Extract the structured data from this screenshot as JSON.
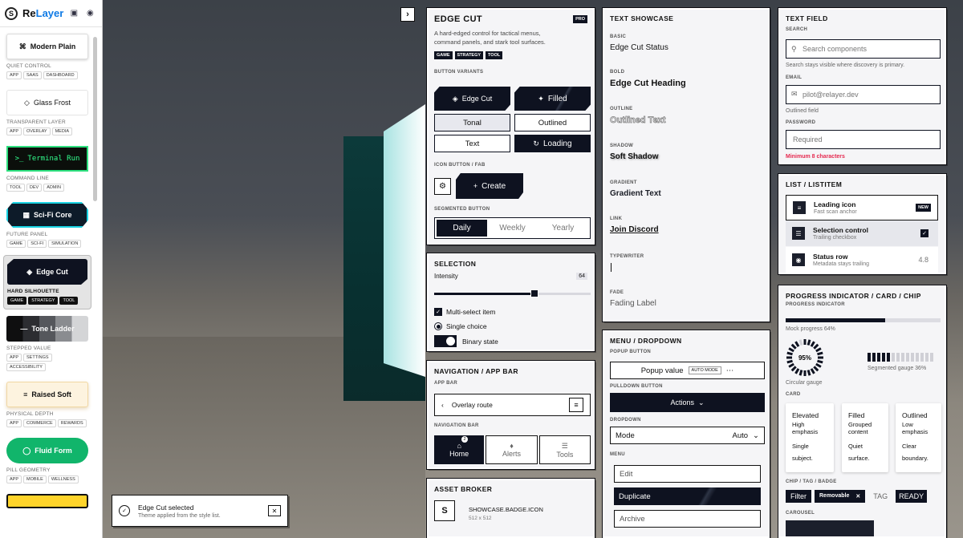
{
  "brand": {
    "name_a": "Re",
    "name_b": "Layer"
  },
  "styles": [
    {
      "name": "Modern Plain",
      "subtitle": "QUIET CONTROL",
      "chips": [
        "APP",
        "SAAS",
        "DASHBOARD"
      ],
      "icon": "command-icon"
    },
    {
      "name": "Glass Frost",
      "subtitle": "TRANSPARENT LAYER",
      "chips": [
        "APP",
        "OVERLAY",
        "MEDIA"
      ],
      "icon": "diamond-icon"
    },
    {
      "name": "Terminal Run",
      "subtitle": "COMMAND LINE",
      "chips": [
        "TOOL",
        "DEV",
        "ADMIN"
      ],
      "prefix": ">_"
    },
    {
      "name": "Sci-Fi Core",
      "subtitle": "FUTURE PANEL",
      "chips": [
        "GAME",
        "SCI-FI",
        "SIMULATION"
      ],
      "icon": "chip-icon"
    },
    {
      "name": "Edge Cut",
      "subtitle": "HARD SILHOUETTE",
      "chips": [
        "GAME",
        "STRATEGY",
        "TOOL"
      ],
      "icon": "tag-icon",
      "selected": true
    },
    {
      "name": "Tone Ladder",
      "subtitle": "STEPPED VALUE",
      "chips": [
        "APP",
        "SETTINGS",
        "ACCESSIBILITY"
      ],
      "icon": "dash-icon"
    },
    {
      "name": "Raised Soft",
      "subtitle": "PHYSICAL DEPTH",
      "chips": [
        "APP",
        "COMMERCE",
        "REWARDS"
      ],
      "icon": "layers-icon"
    },
    {
      "name": "Fluid Form",
      "subtitle": "PILL GEOMETRY",
      "chips": [
        "APP",
        "MOBILE",
        "WELLNESS"
      ],
      "icon": "circle-icon"
    }
  ],
  "toast": {
    "title": "Edge Cut selected",
    "body": "Theme applied from the style list."
  },
  "edgecut": {
    "title": "EDGE CUT",
    "pro": "PRO",
    "desc1": "A hard-edged control for tactical menus,",
    "desc2": "command panels, and stark tool surfaces.",
    "tags": [
      "GAME",
      "STRATEGY",
      "TOOL"
    ],
    "variants_label": "BUTTON VARIANTS",
    "b1": "Edge Cut",
    "b2": "Filled",
    "b3": "Tonal",
    "b4": "Outlined",
    "b5": "Text",
    "b6": "Loading",
    "fab_label": "ICON BUTTON / FAB",
    "create": "Create",
    "seg_label": "SEGMENTED BUTTON",
    "seg": [
      "Daily",
      "Weekly",
      "Yearly"
    ]
  },
  "selection": {
    "title": "SELECTION",
    "intensity_label": "Intensity",
    "intensity": 64,
    "multi": "Multi-select item",
    "single": "Single choice",
    "binary": "Binary state"
  },
  "nav": {
    "title": "NAVIGATION / APP BAR",
    "appbar_label": "APP BAR",
    "route": "Overlay route",
    "navbar_label": "NAVIGATION BAR",
    "items": [
      "Home",
      "Alerts",
      "Tools"
    ],
    "badge": "2"
  },
  "asset": {
    "title": "ASSET BROKER",
    "name": "SHOWCASE.BADGE.ICON",
    "size": "512 x 512"
  },
  "text": {
    "title": "TEXT SHOWCASE",
    "rows": [
      {
        "label": "BASIC",
        "text": "Edge Cut Status"
      },
      {
        "label": "BOLD",
        "text": "Edge Cut Heading"
      },
      {
        "label": "OUTLINE",
        "text": "Outlined Text"
      },
      {
        "label": "SHADOW",
        "text": "Soft Shadow"
      },
      {
        "label": "GRADIENT",
        "text": "Gradient Text"
      },
      {
        "label": "LINK",
        "text": "Join Discord"
      },
      {
        "label": "TYPEWRITER",
        "text": ""
      },
      {
        "label": "FADE",
        "text": "Fading Label"
      }
    ]
  },
  "menu": {
    "title": "MENU / DROPDOWN",
    "popup_label": "POPUP BUTTON",
    "popup_value": "Popup value",
    "auto": "AUTO MODE",
    "pulldown_label": "PULLDOWN BUTTON",
    "actions": "Actions",
    "dropdown_label": "DROPDOWN",
    "mode": "Mode",
    "mode_value": "Auto",
    "menu_label": "MENU",
    "items": [
      "Edit",
      "Duplicate",
      "Archive"
    ]
  },
  "textfield": {
    "title": "TEXT FIELD",
    "search_label": "SEARCH",
    "search_ph": "Search components",
    "search_help": "Search stays visible where discovery is primary.",
    "email_label": "EMAIL",
    "email_ph": "pilot@relayer.dev",
    "email_help": "Outlined field",
    "password_label": "PASSWORD",
    "password_ph": "Required",
    "password_err": "Minimum 8 characters"
  },
  "list": {
    "title": "LIST / LISTITEM",
    "items": [
      {
        "t": "Leading icon",
        "s": "Fast scan anchor",
        "trail": "NEW"
      },
      {
        "t": "Selection control",
        "s": "Trailing checkbox"
      },
      {
        "t": "Status row",
        "s": "Metadata stays trailing",
        "trail": "4.8"
      }
    ]
  },
  "progress": {
    "title": "PROGRESS INDICATOR / CARD / CHIP",
    "pi_label": "PROGRESS INDICATOR",
    "mock": "Mock progress 64%",
    "mock_value": 0.64,
    "circ_value": "95%",
    "circ_label": "Circular gauge",
    "seg_label": "Segmented gauge 36%",
    "seg_value": 0.36,
    "card_label": "CARD",
    "cards": [
      {
        "t": "Elevated",
        "a": "High",
        "b": "emphasis",
        "c": "Single",
        "d": "subject."
      },
      {
        "t": "Filled",
        "a": "Grouped",
        "b": "content",
        "c": "Quiet",
        "d": "surface."
      },
      {
        "t": "Outlined",
        "a": "Low",
        "b": "emphasis",
        "c": "Clear",
        "d": "boundary."
      }
    ],
    "chip_label": "CHIP / TAG / BADGE",
    "chips": [
      "Filter",
      "Removable",
      "TAG",
      "READY"
    ],
    "carousel_label": "CAROUSEL"
  },
  "colors": {
    "dark": "#0e1220",
    "accent": "#0f7ae5",
    "error": "#e5294f",
    "terminal": "#32ff8e"
  }
}
